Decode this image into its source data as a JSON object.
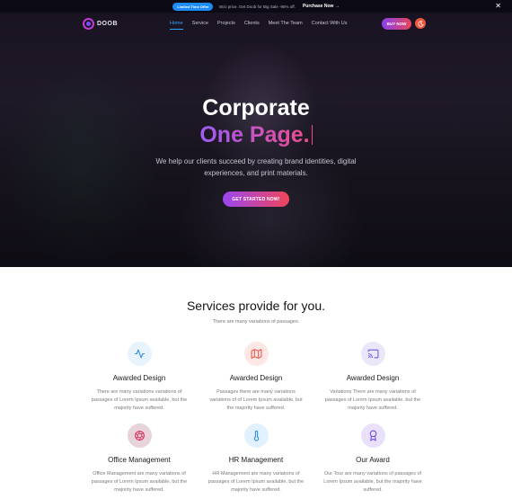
{
  "topbar": {
    "offer_badge": "Limited Time Offer",
    "offer_text": "Intro price. Get Doob for Big Sale -95% off.",
    "purchase_label": "Purchase Now",
    "purchase_arrow": "→",
    "close_glyph": "✕"
  },
  "nav": {
    "logo_text": "DOOB",
    "items": [
      {
        "label": "Home",
        "active": true
      },
      {
        "label": "Service"
      },
      {
        "label": "Projects"
      },
      {
        "label": "Clients"
      },
      {
        "label": "Meet The Team"
      },
      {
        "label": "Contact With Us"
      }
    ],
    "buy_label": "BUY NOW"
  },
  "hero": {
    "title_line1": "Corporate",
    "title_line2": "One Page.",
    "subtitle": "We help our clients succeed by creating brand identities, digital experiences, and print materials.",
    "cta_label": "GET STARTED NOW!"
  },
  "services": {
    "title": "Services provide for you.",
    "subtitle": "There are many variations of passages.",
    "cards": [
      {
        "title": "Awarded Design",
        "desc": "There are many variations variations of passages of Lorem Ipsum available, but the majority have suffered.",
        "icon": "activity-icon",
        "bg": "#e8f4fd",
        "fg": "#2f8fde"
      },
      {
        "title": "Awarded Design",
        "desc": "Passages there are many variations variations of of Lorem Ipsum available, but the majority have suffered.",
        "icon": "map-icon",
        "bg": "#fde8e6",
        "fg": "#ef5a49"
      },
      {
        "title": "Awarded Design",
        "desc": "Variations There are many variations of passages of Lorem Ipsum available, but the majority have suffered.",
        "icon": "cast-icon",
        "bg": "#ebe7fb",
        "fg": "#6f5de0"
      },
      {
        "title": "Office Management",
        "desc": "Office Management are many variations of passages of Lorem Ipsum available, but the majority have suffered.",
        "icon": "aperture-icon",
        "bg": "#e7d3da",
        "fg": "#d8315b"
      },
      {
        "title": "HR Management",
        "desc": "HR Management are many variations of passages of Lorem Ipsum available, but the majority have suffered.",
        "icon": "thermometer-icon",
        "bg": "#e1f1fd",
        "fg": "#2f8fde"
      },
      {
        "title": "Our Award",
        "desc": "Our Tour are many variations of passages of Lorem Ipsum available, but the majority have suffered.",
        "icon": "award-icon",
        "bg": "#e9e1fb",
        "fg": "#6f4fd8"
      }
    ]
  }
}
